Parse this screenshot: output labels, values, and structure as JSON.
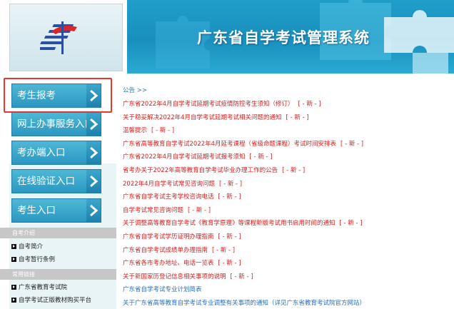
{
  "header": {
    "title": "广东省自学考试管理系统"
  },
  "sidebar": {
    "buttons": [
      {
        "label": "考生报考"
      },
      {
        "label": "网上办事服务入口"
      },
      {
        "label": "考办端入口"
      },
      {
        "label": "在线验证入口"
      },
      {
        "label": "考生入口"
      }
    ],
    "sections": [
      {
        "title": "自考介绍",
        "links": [
          "自考简介",
          "自考暂行条例"
        ]
      },
      {
        "title": "常用链接",
        "links": [
          "广东省教育考试院",
          "自学考试正版教材购买平台"
        ]
      }
    ]
  },
  "notices": {
    "heading": "公告 >>",
    "new_tag": "[ - 新 - ]",
    "items": [
      {
        "text": "广东省2022年4月自学考试延期考试疫情防控考生须知（修订）",
        "new": true,
        "blue": false
      },
      {
        "text": "关于稳妥解决2022年4月自学考试延期考试相关问题的通知",
        "new": true,
        "blue": false
      },
      {
        "text": "温馨提示",
        "new": true,
        "blue": false
      },
      {
        "text": "广东省高等教育自学考试2022年4月延考课程（省级命题课程）考试时间安排表",
        "new": true,
        "blue": false
      },
      {
        "text": "广东省2022年4月自学考试延期考试报考须知",
        "new": true,
        "blue": false
      },
      {
        "text": "省考办关于2022年高等教育自学考试毕业办理工作的公告",
        "new": true,
        "blue": false
      },
      {
        "text": "2022年4月自学考试常见咨询问题",
        "new": true,
        "blue": false
      },
      {
        "text": "广东省自学考试主考学校咨询电话",
        "new": true,
        "blue": false
      },
      {
        "text": "自学考试常见咨询问题",
        "new": true,
        "blue": false
      },
      {
        "text": "关于调整高等教育自学考试《教育学原理》等课程新版考试用书启用时间的通知",
        "new": true,
        "blue": false
      },
      {
        "text": "广东省自学考试学历证明办理指南",
        "new": true,
        "blue": false
      },
      {
        "text": "广东省自学考试成绩单办理指南",
        "new": true,
        "blue": false
      },
      {
        "text": "广东省各市考办地址、电话一览表",
        "new": true,
        "blue": false
      },
      {
        "text": "关于新国家历登记信息相关事项的说明",
        "new": true,
        "blue": false
      },
      {
        "text": "广东省自学考试专业计划简表",
        "new": false,
        "blue": true
      },
      {
        "text": "关于广东省高等教育自学考试专业调整有关事项的通知（详见广东省教育考试院官方网站）",
        "new": false,
        "blue": true
      }
    ]
  },
  "colors": {
    "banner": "#1f9ec9",
    "nav_button": "#2b98c2",
    "highlight": "#e8372c",
    "notice_red": "#d81e1e",
    "notice_blue": "#2a6fbd"
  }
}
